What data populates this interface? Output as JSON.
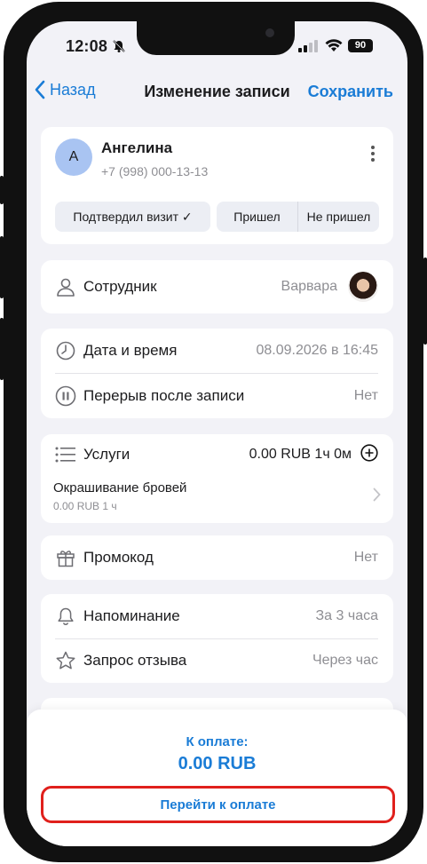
{
  "status_bar": {
    "time": "12:08",
    "battery": "90"
  },
  "nav": {
    "back_label": "Назад",
    "title": "Изменение записи",
    "save_label": "Сохранить"
  },
  "client": {
    "avatar_letter": "А",
    "name": "Ангелина",
    "phone": "+7 (998) 000-13-13",
    "confirm_label": "Подтвердил визит ✓",
    "came_label": "Пришел",
    "not_came_label": "Не пришел"
  },
  "staff": {
    "label": "Сотрудник",
    "value": "Варвара"
  },
  "datetime": {
    "label": "Дата и время",
    "value": "08.09.2026 в 16:45",
    "break_label": "Перерыв после записи",
    "break_value": "Нет"
  },
  "services": {
    "label": "Услуги",
    "summary": "0.00 RUB 1ч 0м",
    "items": [
      {
        "name": "Окрашивание бровей",
        "details": "0.00 RUB 1 ч"
      }
    ]
  },
  "promo": {
    "label": "Промокод",
    "value": "Нет"
  },
  "notifications": {
    "reminder_label": "Напоминание",
    "reminder_value": "За 3 часа",
    "review_label": "Запрос отзыва",
    "review_value": "Через час"
  },
  "payment": {
    "label": "К оплате:",
    "amount": "0.00 RUB",
    "button_label": "Перейти к оплате"
  },
  "colors": {
    "accent": "#1a7cd6",
    "highlight": "#e0201c",
    "background": "#f2f2f7",
    "avatar": "#a9c4f2"
  },
  "icons": [
    "bell-slash-icon",
    "signal-icon",
    "wifi-icon",
    "chevron-left-icon",
    "more-vertical-icon",
    "person-icon",
    "clock-icon",
    "pause-icon",
    "list-icon",
    "plus-circle-icon",
    "chevron-right-icon",
    "gift-icon",
    "bell-icon",
    "star-icon"
  ]
}
